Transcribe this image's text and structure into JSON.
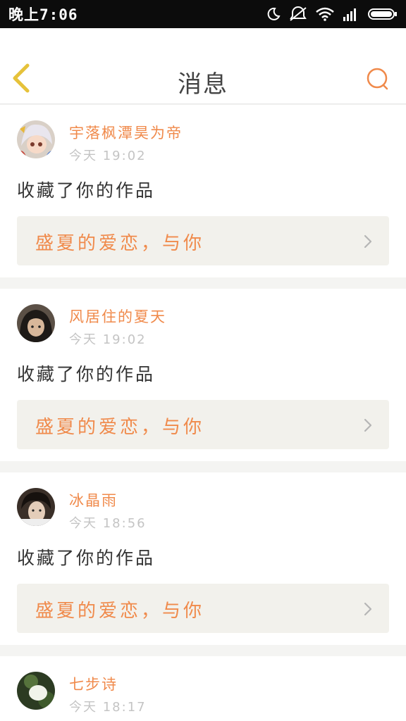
{
  "status_bar": {
    "time": "晚上7:06",
    "icons": [
      "moon-icon",
      "mute-icon",
      "wifi-icon",
      "signal-icon",
      "battery-icon"
    ]
  },
  "header": {
    "title": "消息",
    "back_icon": "chevron-left-icon",
    "search_icon": "search-icon"
  },
  "colors": {
    "accent": "#f08a4b",
    "back_icon": "#e6c23a",
    "card_link_bg": "#f2f1ec",
    "page_bg": "#f4f4f2"
  },
  "messages": [
    {
      "username": "宇落枫潭昊为帝",
      "time": "今天 19:02",
      "action": "收藏了你的作品",
      "work_title": "盛夏的爱恋，与你"
    },
    {
      "username": "风居住的夏天",
      "time": "今天 19:02",
      "action": "收藏了你的作品",
      "work_title": "盛夏的爱恋，与你"
    },
    {
      "username": "冰晶雨",
      "time": "今天 18:56",
      "action": "收藏了你的作品",
      "work_title": "盛夏的爱恋，与你"
    },
    {
      "username": "七步诗",
      "time": "今天 18:17"
    }
  ]
}
